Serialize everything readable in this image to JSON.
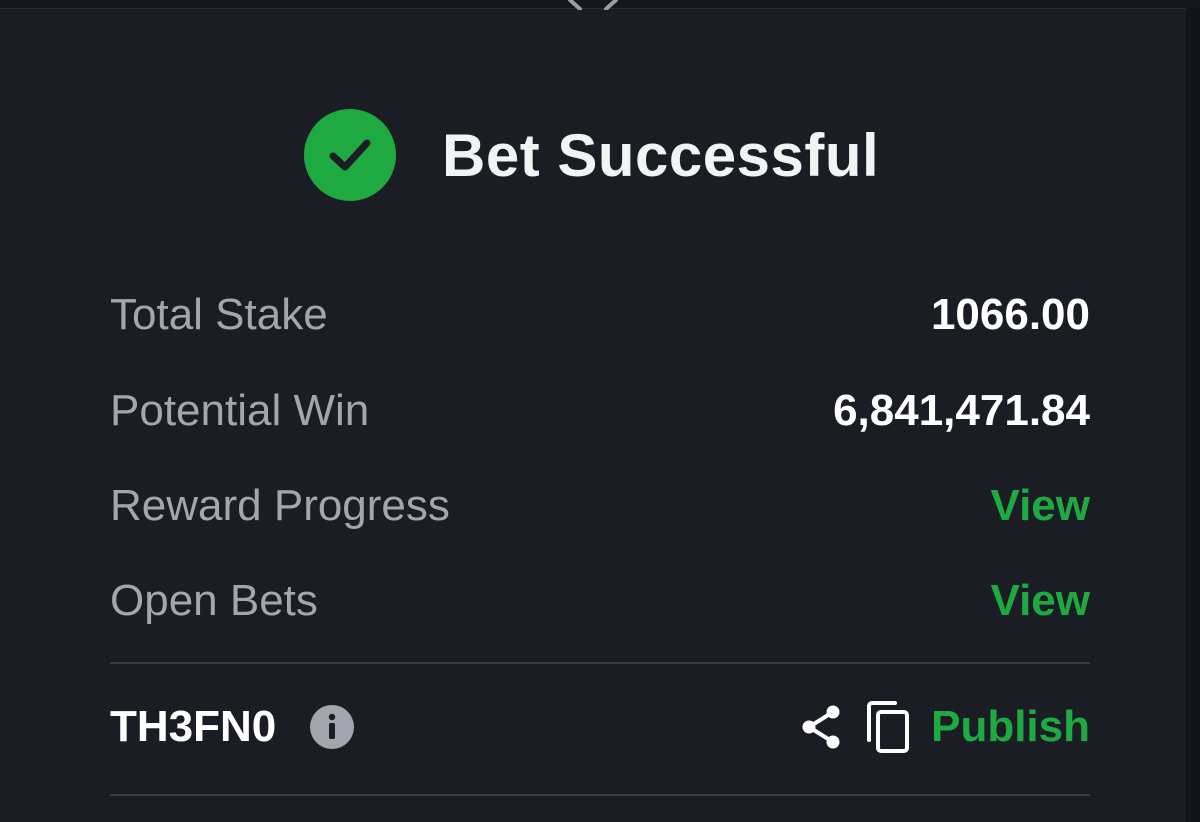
{
  "header": {
    "title": "Bet Successful",
    "status_icon": "check-circle-icon"
  },
  "summary": {
    "total_stake_label": "Total Stake",
    "total_stake_value": "1066.00",
    "potential_win_label": "Potential Win",
    "potential_win_value": "6,841,471.84",
    "reward_progress_label": "Reward Progress",
    "reward_progress_link": "View",
    "open_bets_label": "Open Bets",
    "open_bets_link": "View"
  },
  "footer": {
    "ticket_code": "TH3FN0",
    "info_icon": "info-icon",
    "share_icon": "share-icon",
    "copy_icon": "copy-icon",
    "publish_label": "Publish"
  },
  "colors": {
    "background": "#1b1d24",
    "accent_green": "#1faa41",
    "label_gray": "#a3a6ae",
    "value_white": "#ffffff"
  }
}
